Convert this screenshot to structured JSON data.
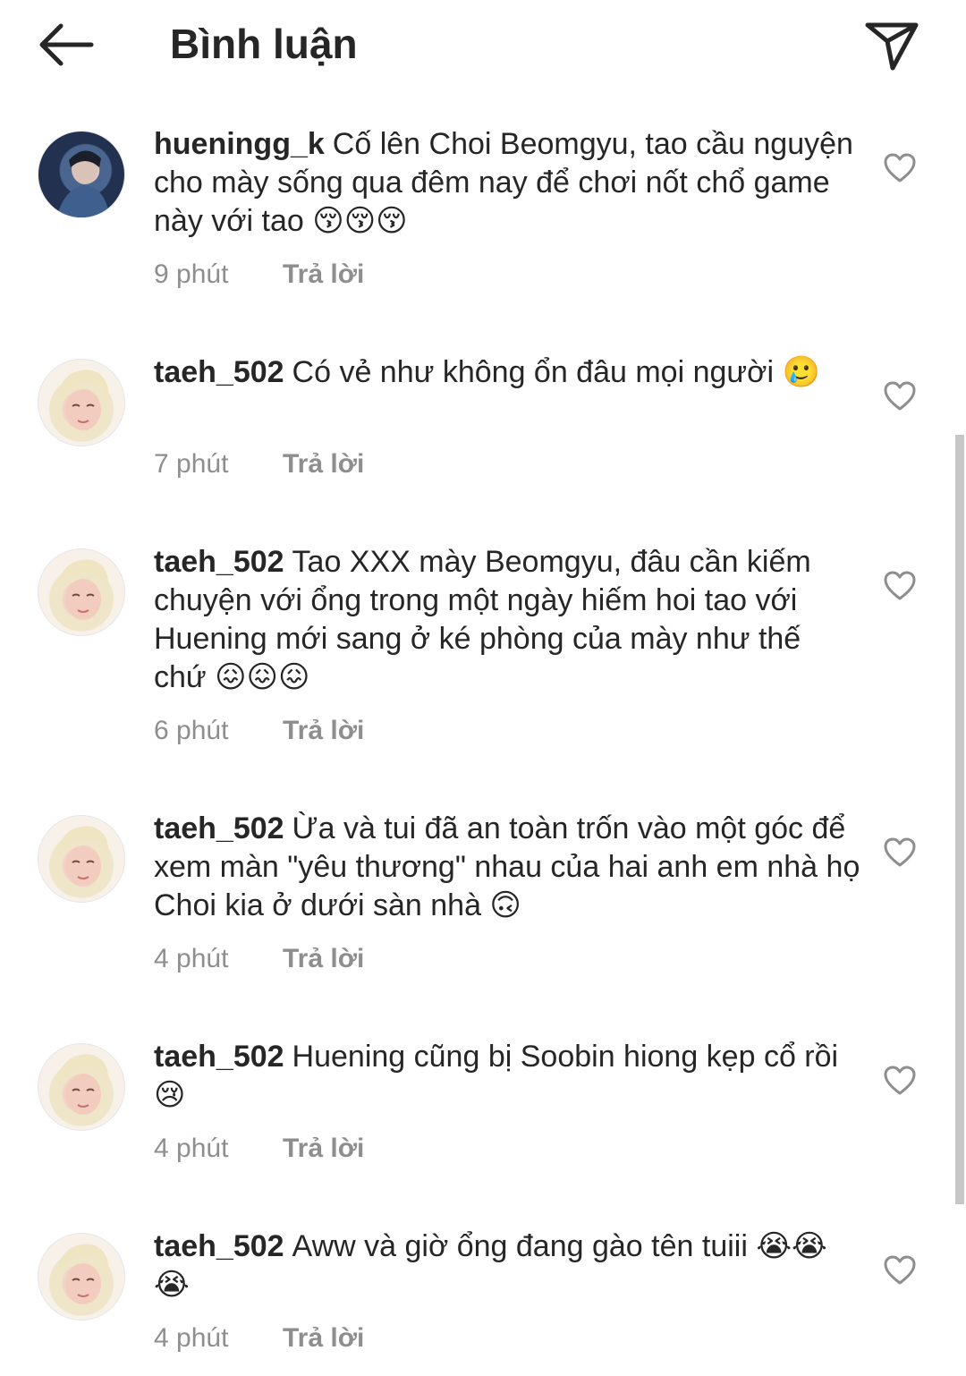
{
  "header": {
    "title": "Bình luận",
    "back_icon": "arrow-left-icon",
    "send_icon": "paper-plane-icon"
  },
  "reply_label": "Trả lời",
  "colors": {
    "text": "#262626",
    "muted": "#8e8e8e"
  },
  "comments": [
    {
      "username": "hueningg_k",
      "text": "Cố lên Choi Beomgyu, tao cầu nguyện cho mày sống qua đêm nay để chơi nốt chổ game này với tao 😚😚😚",
      "time": "9 phút"
    },
    {
      "username": "taeh_502",
      "text": "Có vẻ như không ổn đâu mọi người 🥲",
      "time": "7 phút"
    },
    {
      "username": "taeh_502",
      "text": "Tao XXX mày Beomgyu, đâu cần kiếm chuyện với ổng trong một ngày hiếm hoi tao với Huening mới sang ở ké phòng của mày như thế chứ 😖😖😖",
      "time": "6 phút"
    },
    {
      "username": "taeh_502",
      "text": "Ừa và tui đã an toàn trốn vào một góc để xem màn \"yêu thương\" nhau của hai anh em nhà họ Choi kia ở dưới sàn nhà 🙃",
      "time": "4 phút"
    },
    {
      "username": "taeh_502",
      "text": "Huening cũng bị Soobin hiong kẹp cổ rồi 😢",
      "time": "4 phút"
    },
    {
      "username": "taeh_502",
      "text": "Aww và giờ ổng đang gào tên tuiii 😭😭😭",
      "time": "4 phút"
    }
  ]
}
